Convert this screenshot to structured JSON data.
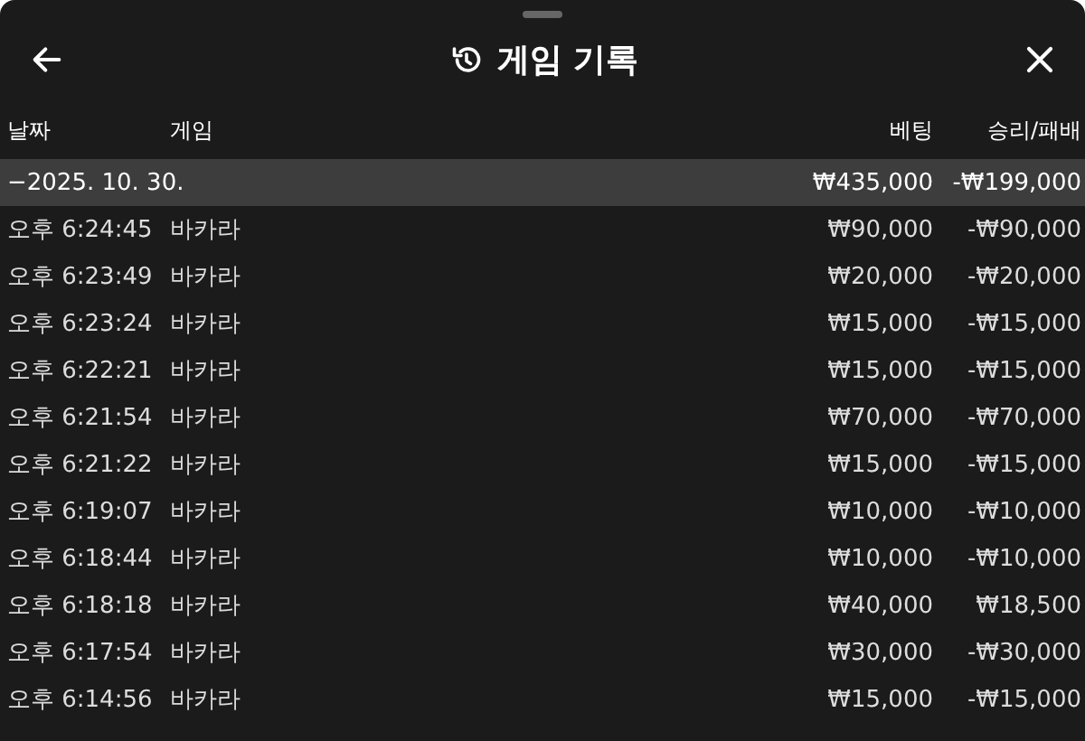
{
  "header": {
    "title": "게임 기록"
  },
  "table": {
    "columns": [
      "날짜",
      "게임",
      "베팅",
      "승리/패배"
    ],
    "group": {
      "date": "−2025. 10. 30.",
      "bet": "₩435,000",
      "result": "-₩199,000"
    },
    "rows": [
      {
        "time": "오후 6:24:45",
        "game": "바카라",
        "bet": "₩90,000",
        "result": "-₩90,000"
      },
      {
        "time": "오후 6:23:49",
        "game": "바카라",
        "bet": "₩20,000",
        "result": "-₩20,000"
      },
      {
        "time": "오후 6:23:24",
        "game": "바카라",
        "bet": "₩15,000",
        "result": "-₩15,000"
      },
      {
        "time": "오후 6:22:21",
        "game": "바카라",
        "bet": "₩15,000",
        "result": "-₩15,000"
      },
      {
        "time": "오후 6:21:54",
        "game": "바카라",
        "bet": "₩70,000",
        "result": "-₩70,000"
      },
      {
        "time": "오후 6:21:22",
        "game": "바카라",
        "bet": "₩15,000",
        "result": "-₩15,000"
      },
      {
        "time": "오후 6:19:07",
        "game": "바카라",
        "bet": "₩10,000",
        "result": "-₩10,000"
      },
      {
        "time": "오후 6:18:44",
        "game": "바카라",
        "bet": "₩10,000",
        "result": "-₩10,000"
      },
      {
        "time": "오후 6:18:18",
        "game": "바카라",
        "bet": "₩40,000",
        "result": "₩18,500"
      },
      {
        "time": "오후 6:17:54",
        "game": "바카라",
        "bet": "₩30,000",
        "result": "-₩30,000"
      },
      {
        "time": "오후 6:14:56",
        "game": "바카라",
        "bet": "₩15,000",
        "result": "-₩15,000"
      }
    ]
  }
}
